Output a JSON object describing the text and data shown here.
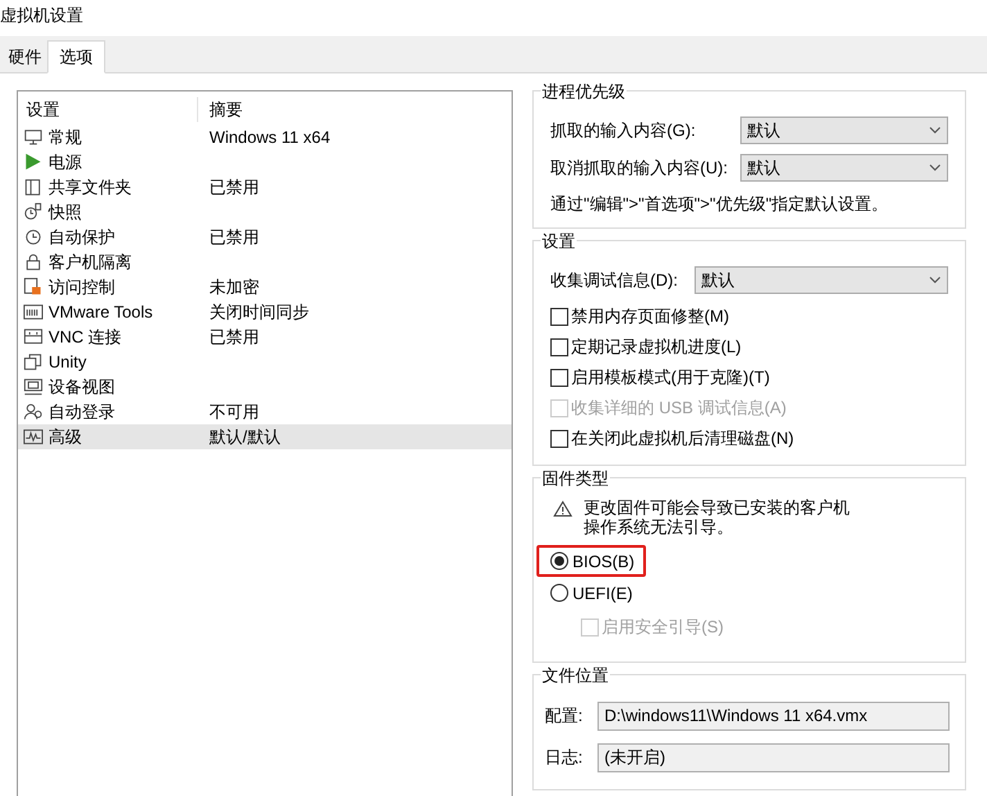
{
  "window": {
    "title": "虚拟机设置"
  },
  "tabs": [
    {
      "label": "硬件",
      "selected": false
    },
    {
      "label": "选项",
      "selected": true
    }
  ],
  "settings_list": {
    "columns": [
      "设置",
      "摘要"
    ],
    "rows": [
      {
        "name": "常规",
        "summary": "Windows 11 x64",
        "selected": false
      },
      {
        "name": "电源",
        "selected": false
      },
      {
        "name": "共享文件夹",
        "summary": "已禁用",
        "selected": false
      },
      {
        "name": "快照",
        "selected": false
      },
      {
        "name": "自动保护",
        "summary": "已禁用",
        "selected": false
      },
      {
        "name": "客户机隔离",
        "selected": false
      },
      {
        "name": "访问控制",
        "summary": "未加密",
        "selected": false
      },
      {
        "name": "VMware Tools",
        "summary": "关闭时间同步",
        "selected": false
      },
      {
        "name": "VNC 连接",
        "summary": "已禁用",
        "selected": false
      },
      {
        "name": "Unity",
        "selected": false
      },
      {
        "name": "设备视图",
        "selected": false
      },
      {
        "name": "自动登录",
        "summary": "不可用",
        "selected": false
      },
      {
        "name": "高级",
        "summary": "默认/默认",
        "selected": true
      }
    ]
  },
  "process_priority": {
    "title": "进程优先级",
    "fields": [
      {
        "label": "抓取的输入内容(G):",
        "value": "默认"
      },
      {
        "label": "取消抓取的输入内容(U):",
        "value": "默认"
      }
    ],
    "note": "通过\"编辑\">\"首选项\">\"优先级\"指定默认设置。"
  },
  "settings": {
    "title": "设置",
    "debug_field": {
      "label": "收集调试信息(D):",
      "value": "默认"
    },
    "checkboxes": [
      {
        "label": "禁用内存页面修整(M)",
        "checked": false,
        "disabled": false
      },
      {
        "label": "定期记录虚拟机进度(L)",
        "checked": false,
        "disabled": false
      },
      {
        "label": "启用模板模式(用于克隆)(T)",
        "checked": false,
        "disabled": false
      },
      {
        "label": "收集详细的 USB 调试信息(A)",
        "checked": false,
        "disabled": true
      },
      {
        "label": "在关闭此虚拟机后清理磁盘(N)",
        "checked": false,
        "disabled": false
      }
    ]
  },
  "firmware": {
    "title": "固件类型",
    "warning": [
      "更改固件可能会导致已安装的客户机",
      "操作系统无法引导。"
    ],
    "options": [
      {
        "label": "BIOS(B)",
        "selected": true,
        "highlighted": true
      },
      {
        "label": "UEFI(E)",
        "selected": false,
        "highlighted": false
      }
    ],
    "secure_boot": {
      "label": "启用安全引导(S)",
      "checked": false,
      "disabled": true
    }
  },
  "file_location": {
    "title": "文件位置",
    "fields": [
      {
        "label": "配置:",
        "value": "D:\\windows11\\Windows 11 x64.vmx"
      },
      {
        "label": "日志:",
        "value": "(未开启)"
      }
    ]
  }
}
